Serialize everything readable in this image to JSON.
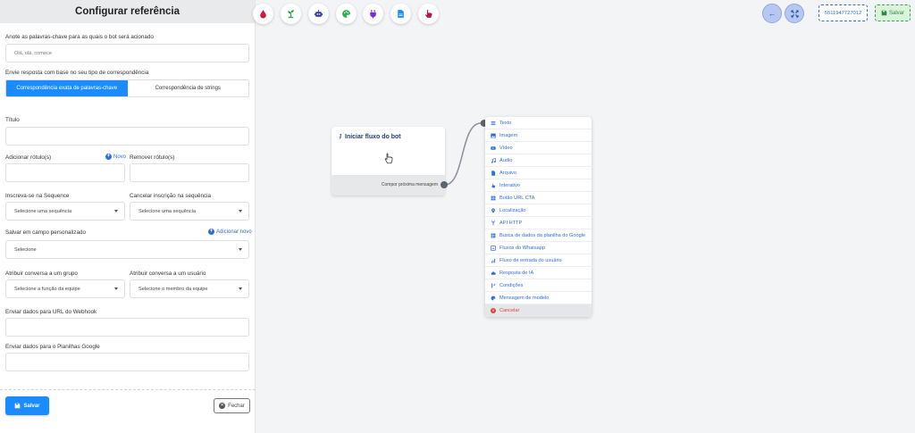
{
  "panel": {
    "title": "Configurar referência",
    "keywords_label": "Anote as palavras-chave para as quais o bot será acionado",
    "keywords_placeholder": "Olá, olá, comece",
    "match_label": "Envie resposta com base no seu tipo de correspondência",
    "match_exact": "Correspondência exata de palavras-chave",
    "match_string": "Correspondência de strings",
    "title_label": "Título",
    "add_tag_label": "Adicionar rótulo(s)",
    "new_label": "Novo",
    "remove_tag_label": "Remover rótulo(s)",
    "subscribe_label": "Inscreva-se na Sequence",
    "subscribe_value": "Selecione uma sequência",
    "unsubscribe_label": "Cancelar inscrição na sequência",
    "unsubscribe_value": "Selecione uma sequência",
    "custom_field_label": "Salvar em campo personalizado",
    "add_new_label": "Adicionar novo",
    "custom_field_value": "Selecione",
    "group_label": "Atribuir conversa a um grupo",
    "group_value": "Selecione a função da equipe",
    "user_label": "Atribuir conversa a um usuário",
    "user_value": "Selecione o membro da equipe",
    "webhook_label": "Enviar dados para URL do Webhook",
    "sheets_label": "Enviar dados para o Planilhas Google",
    "save_label": "Salvar",
    "close_label": "Fechar"
  },
  "toolbar": {
    "phone": "5511947727012",
    "save_label": "Salvar",
    "tool_icons": [
      "drop-icon",
      "plant-icon",
      "robot-icon",
      "palette-icon",
      "plug-icon",
      "document-icon",
      "pointer-icon"
    ]
  },
  "node": {
    "title": "Iniciar fluxo do bot",
    "footer": "Compor próxima mensagem"
  },
  "menu": {
    "items": [
      {
        "label": "Texto",
        "icon": "list-icon"
      },
      {
        "label": "Imagem",
        "icon": "image-icon"
      },
      {
        "label": "Vídeo",
        "icon": "video-icon"
      },
      {
        "label": "Áudio",
        "icon": "music-icon"
      },
      {
        "label": "Arquivo",
        "icon": "file-icon"
      },
      {
        "label": "Interativo",
        "icon": "interactive-icon"
      },
      {
        "label": "Botão URL CTA",
        "icon": "grid-icon"
      },
      {
        "label": "Localização",
        "icon": "location-icon"
      },
      {
        "label": "API HTTP",
        "icon": "api-icon"
      },
      {
        "label": "Busca de dados da planilha do Google",
        "icon": "sheet-icon"
      },
      {
        "label": "Fluxos do Whatsapp",
        "icon": "flow-icon"
      },
      {
        "label": "Fluxo de entrada do usuário",
        "icon": "chart-icon"
      },
      {
        "label": "Resposta de IA",
        "icon": "cloud-icon"
      },
      {
        "label": "Condições",
        "icon": "branch-icon"
      },
      {
        "label": "Mensagem de modelo",
        "icon": "template-icon"
      }
    ],
    "cancel_label": "Cancelar"
  },
  "colors": {
    "accent": "#1a8cff",
    "link": "#2f6fd6",
    "danger": "#e0443a",
    "success": "#3aa24a"
  }
}
